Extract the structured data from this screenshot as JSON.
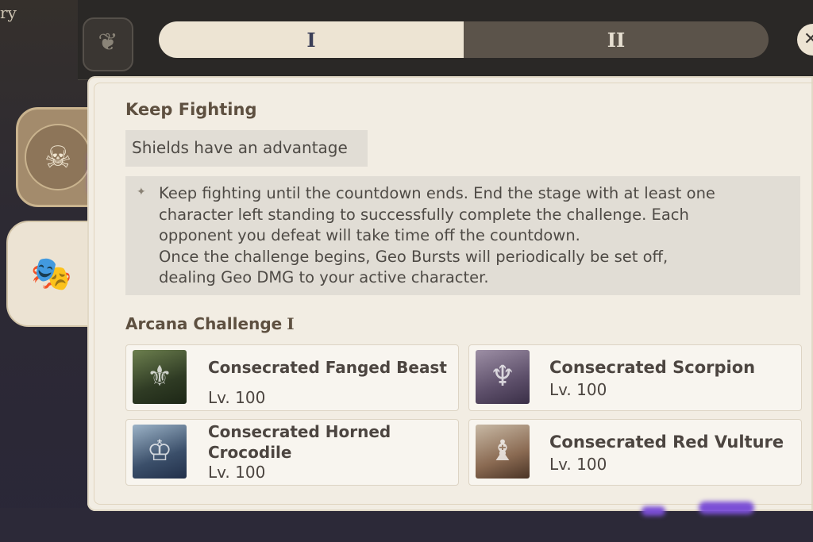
{
  "background": {
    "title_fragment": "ry"
  },
  "tabs": [
    {
      "label": "I",
      "active": true
    },
    {
      "label": "II",
      "active": false
    }
  ],
  "close_icon": "close-icon",
  "side_tabs": [
    {
      "icon": "skull-shield-icon"
    },
    {
      "icon": "masks-icon"
    }
  ],
  "stage": {
    "title": "Keep Fighting",
    "subtitle": "Shields have an advantage",
    "description_lines": [
      "Keep fighting until the countdown ends. End the stage with at least one",
      "character left standing to successfully complete the challenge. Each",
      "opponent you defeat will take time off the countdown.",
      "Once the challenge begins, Geo Bursts will periodically be set off,",
      "dealing Geo DMG to your active character."
    ]
  },
  "arcana": {
    "title": "Arcana Challenge",
    "numeral": "I"
  },
  "enemies": [
    {
      "name": "Consecrated Fanged Beast",
      "level": "Lv. 100"
    },
    {
      "name": "Consecrated Scorpion",
      "level": "Lv. 100"
    },
    {
      "name": "Consecrated Horned Crocodile",
      "level": "Lv. 100"
    },
    {
      "name": "Consecrated Red Vulture",
      "level": "Lv. 100"
    }
  ],
  "colors": {
    "panel_bg": "#f2ede3",
    "tab_active": "#ede4d3",
    "tab_inactive": "#5b534a",
    "accent_glow": "#7b4fd6"
  }
}
